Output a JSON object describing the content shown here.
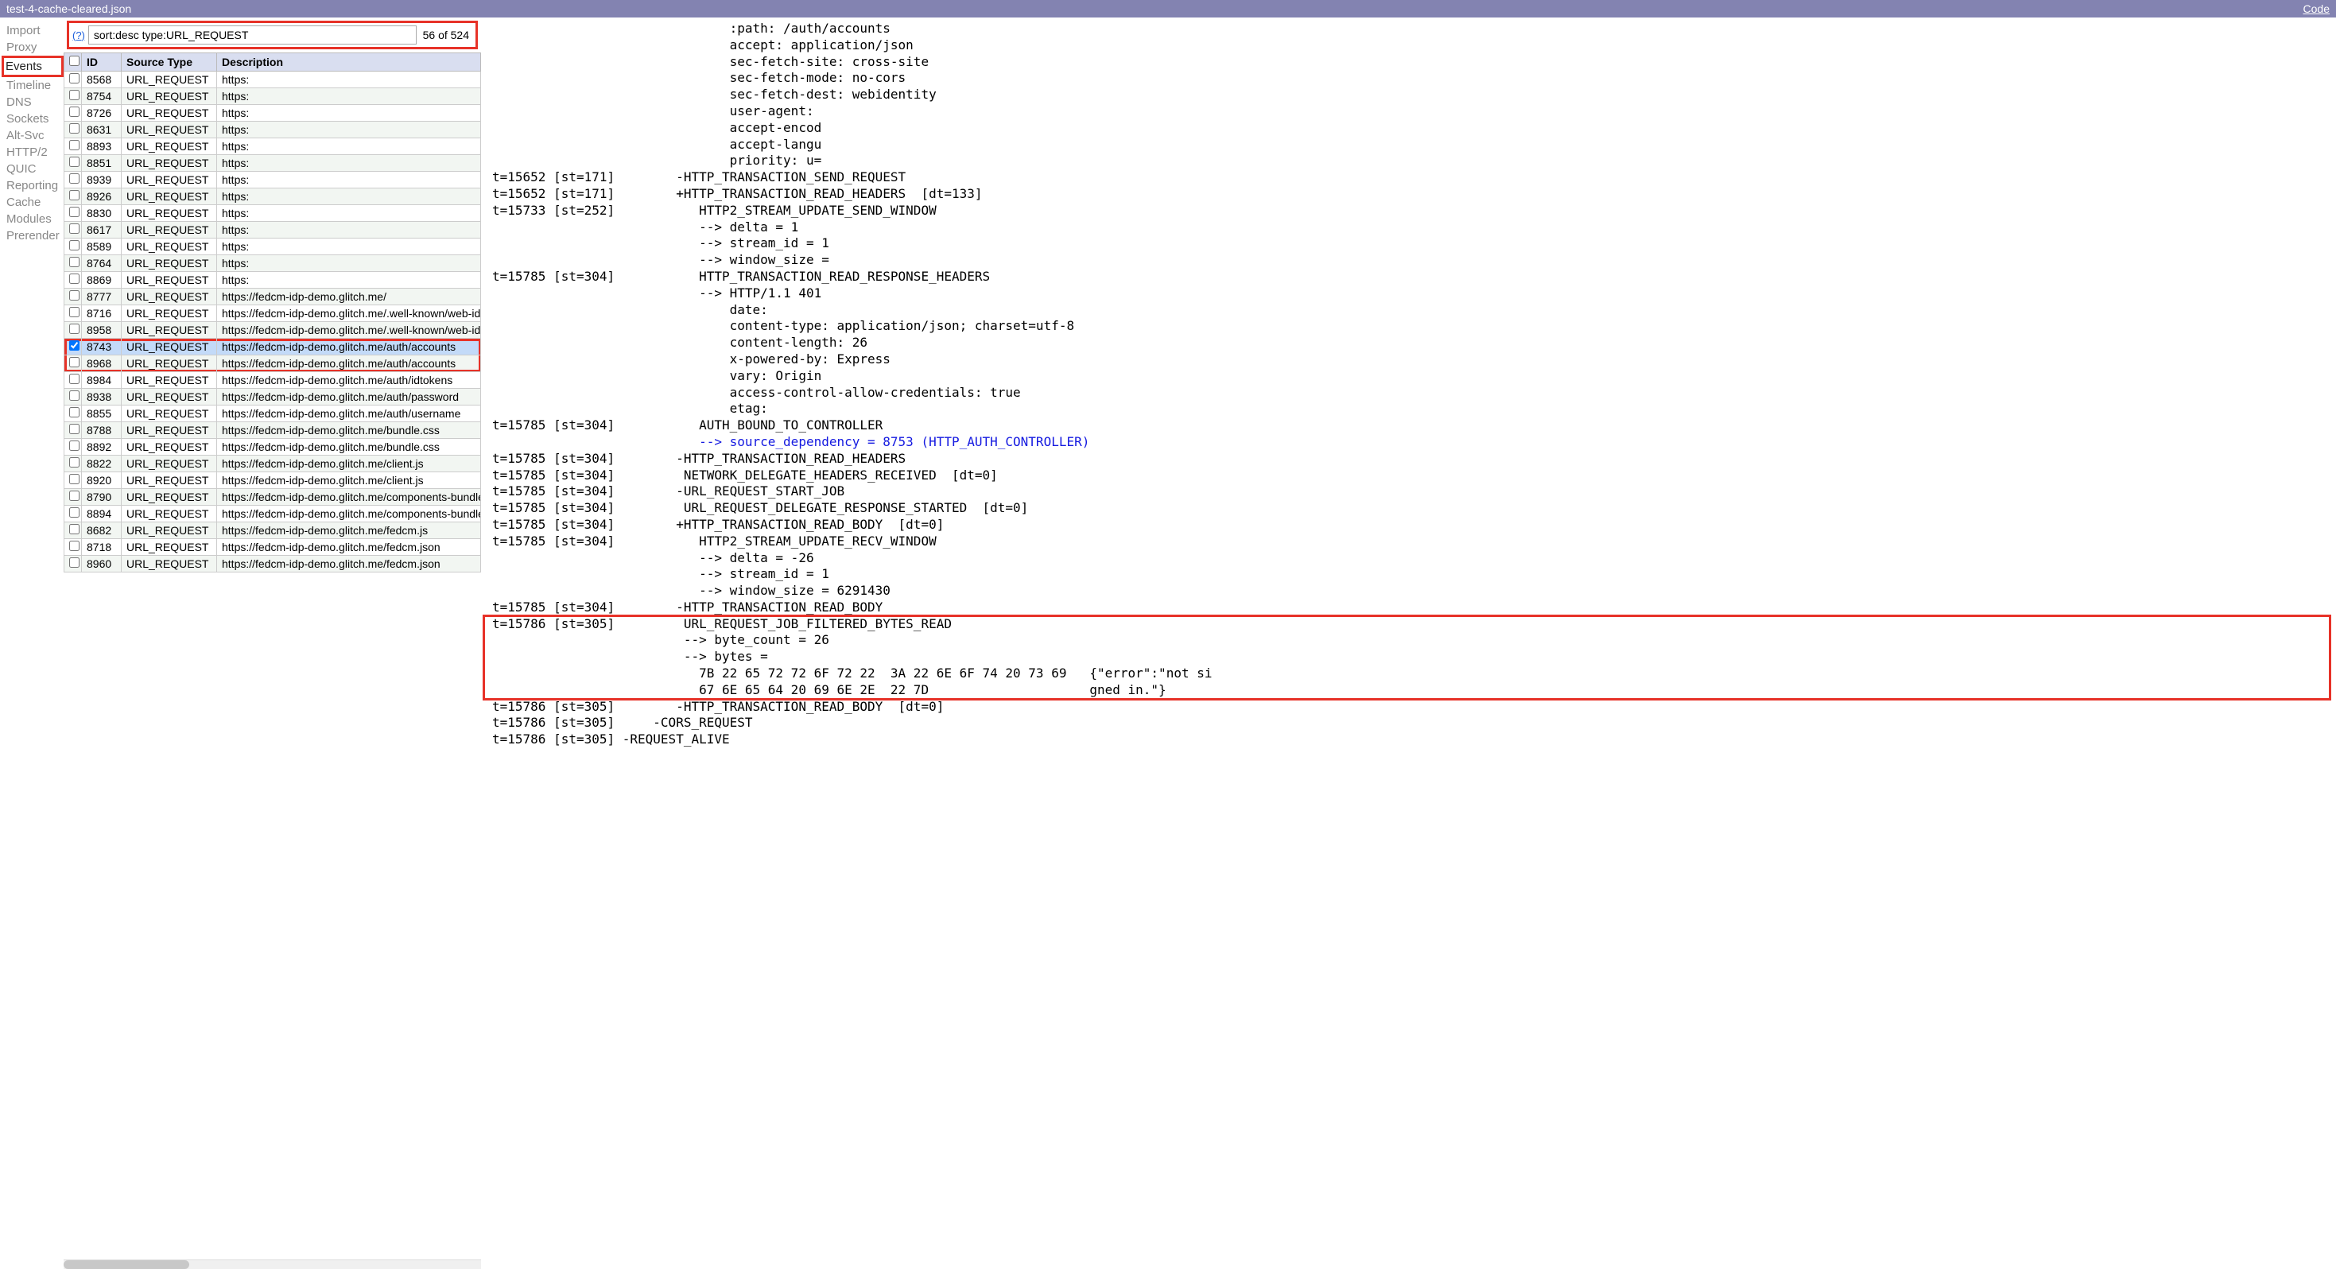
{
  "title": "test-4-cache-cleared.json",
  "code_link": "Code",
  "sidebar": {
    "items": [
      {
        "label": "Import",
        "active": false
      },
      {
        "label": "Proxy",
        "active": false
      },
      {
        "label": "Events",
        "active": true
      },
      {
        "label": "Timeline",
        "active": false
      },
      {
        "label": "DNS",
        "active": false
      },
      {
        "label": "Sockets",
        "active": false
      },
      {
        "label": "Alt-Svc",
        "active": false
      },
      {
        "label": "HTTP/2",
        "active": false
      },
      {
        "label": "QUIC",
        "active": false
      },
      {
        "label": "Reporting",
        "active": false
      },
      {
        "label": "Cache",
        "active": false
      },
      {
        "label": "Modules",
        "active": false
      },
      {
        "label": "Prerender",
        "active": false
      }
    ]
  },
  "filter": {
    "help": "(?)",
    "value": "sort:desc type:URL_REQUEST",
    "count": "56 of 524"
  },
  "columns": {
    "cb": "",
    "id": "ID",
    "st": "Source Type",
    "desc": "Description"
  },
  "rows": [
    {
      "id": "8568",
      "type": "URL_REQUEST",
      "desc": "https:"
    },
    {
      "id": "8754",
      "type": "URL_REQUEST",
      "desc": "https:"
    },
    {
      "id": "8726",
      "type": "URL_REQUEST",
      "desc": "https:"
    },
    {
      "id": "8631",
      "type": "URL_REQUEST",
      "desc": "https:"
    },
    {
      "id": "8893",
      "type": "URL_REQUEST",
      "desc": "https:"
    },
    {
      "id": "8851",
      "type": "URL_REQUEST",
      "desc": "https:"
    },
    {
      "id": "8939",
      "type": "URL_REQUEST",
      "desc": "https:"
    },
    {
      "id": "8926",
      "type": "URL_REQUEST",
      "desc": "https:"
    },
    {
      "id": "8830",
      "type": "URL_REQUEST",
      "desc": "https:"
    },
    {
      "id": "8617",
      "type": "URL_REQUEST",
      "desc": "https:"
    },
    {
      "id": "8589",
      "type": "URL_REQUEST",
      "desc": "https:"
    },
    {
      "id": "8764",
      "type": "URL_REQUEST",
      "desc": "https:"
    },
    {
      "id": "8869",
      "type": "URL_REQUEST",
      "desc": "https:"
    },
    {
      "id": "8777",
      "type": "URL_REQUEST",
      "desc": "https://fedcm-idp-demo.glitch.me/"
    },
    {
      "id": "8716",
      "type": "URL_REQUEST",
      "desc": "https://fedcm-idp-demo.glitch.me/.well-known/web-iden"
    },
    {
      "id": "8958",
      "type": "URL_REQUEST",
      "desc": "https://fedcm-idp-demo.glitch.me/.well-known/web-iden"
    },
    {
      "id": "8743",
      "type": "URL_REQUEST",
      "desc": "https://fedcm-idp-demo.glitch.me/auth/accounts",
      "selected": true,
      "checked": true,
      "redgroup": true
    },
    {
      "id": "8968",
      "type": "URL_REQUEST",
      "desc": "https://fedcm-idp-demo.glitch.me/auth/accounts",
      "redgroup": true
    },
    {
      "id": "8984",
      "type": "URL_REQUEST",
      "desc": "https://fedcm-idp-demo.glitch.me/auth/idtokens"
    },
    {
      "id": "8938",
      "type": "URL_REQUEST",
      "desc": "https://fedcm-idp-demo.glitch.me/auth/password"
    },
    {
      "id": "8855",
      "type": "URL_REQUEST",
      "desc": "https://fedcm-idp-demo.glitch.me/auth/username"
    },
    {
      "id": "8788",
      "type": "URL_REQUEST",
      "desc": "https://fedcm-idp-demo.glitch.me/bundle.css"
    },
    {
      "id": "8892",
      "type": "URL_REQUEST",
      "desc": "https://fedcm-idp-demo.glitch.me/bundle.css"
    },
    {
      "id": "8822",
      "type": "URL_REQUEST",
      "desc": "https://fedcm-idp-demo.glitch.me/client.js"
    },
    {
      "id": "8920",
      "type": "URL_REQUEST",
      "desc": "https://fedcm-idp-demo.glitch.me/client.js"
    },
    {
      "id": "8790",
      "type": "URL_REQUEST",
      "desc": "https://fedcm-idp-demo.glitch.me/components-bundle.j"
    },
    {
      "id": "8894",
      "type": "URL_REQUEST",
      "desc": "https://fedcm-idp-demo.glitch.me/components-bundle.j"
    },
    {
      "id": "8682",
      "type": "URL_REQUEST",
      "desc": "https://fedcm-idp-demo.glitch.me/fedcm.js"
    },
    {
      "id": "8718",
      "type": "URL_REQUEST",
      "desc": "https://fedcm-idp-demo.glitch.me/fedcm.json"
    },
    {
      "id": "8960",
      "type": "URL_REQUEST",
      "desc": "https://fedcm-idp-demo.glitch.me/fedcm.json"
    }
  ],
  "detail_lines": [
    "                               :path: /auth/accounts",
    "                               accept: application/json",
    "                               sec-fetch-site: cross-site",
    "                               sec-fetch-mode: no-cors",
    "                               sec-fetch-dest: webidentity",
    "                               user-agent:",
    "                               accept-encod",
    "                               accept-langu",
    "                               priority: u=",
    "t=15652 [st=171]        -HTTP_TRANSACTION_SEND_REQUEST",
    "t=15652 [st=171]        +HTTP_TRANSACTION_READ_HEADERS  [dt=133]",
    "t=15733 [st=252]           HTTP2_STREAM_UPDATE_SEND_WINDOW",
    "                           --> delta = 1",
    "                           --> stream_id = 1",
    "                           --> window_size =",
    "t=15785 [st=304]           HTTP_TRANSACTION_READ_RESPONSE_HEADERS",
    "                           --> HTTP/1.1 401",
    "                               date:",
    "                               content-type: application/json; charset=utf-8",
    "                               content-length: 26",
    "                               x-powered-by: Express",
    "                               vary: Origin",
    "                               access-control-allow-credentials: true",
    "                               etag:",
    "t=15785 [st=304]           AUTH_BOUND_TO_CONTROLLER",
    {
      "cls": "blue",
      "text": "                           --> source_dependency = 8753 (HTTP_AUTH_CONTROLLER)"
    },
    "t=15785 [st=304]        -HTTP_TRANSACTION_READ_HEADERS",
    "t=15785 [st=304]         NETWORK_DELEGATE_HEADERS_RECEIVED  [dt=0]",
    "t=15785 [st=304]        -URL_REQUEST_START_JOB",
    "t=15785 [st=304]         URL_REQUEST_DELEGATE_RESPONSE_STARTED  [dt=0]",
    "t=15785 [st=304]        +HTTP_TRANSACTION_READ_BODY  [dt=0]",
    "t=15785 [st=304]           HTTP2_STREAM_UPDATE_RECV_WINDOW",
    "                           --> delta = -26",
    "                           --> stream_id = 1",
    "                           --> window_size = 6291430",
    "t=15785 [st=304]        -HTTP_TRANSACTION_READ_BODY",
    "t=15786 [st=305]         URL_REQUEST_JOB_FILTERED_BYTES_READ",
    "                         --> byte_count = 26",
    "                         --> bytes =",
    "                           7B 22 65 72 72 6F 72 22  3A 22 6E 6F 74 20 73 69   {\"error\":\"not si",
    "                           67 6E 65 64 20 69 6E 2E  22 7D                     gned in.\"}",
    "t=15786 [st=305]        -HTTP_TRANSACTION_READ_BODY  [dt=0]",
    "t=15786 [st=305]     -CORS_REQUEST",
    "t=15786 [st=305] -REQUEST_ALIVE"
  ]
}
